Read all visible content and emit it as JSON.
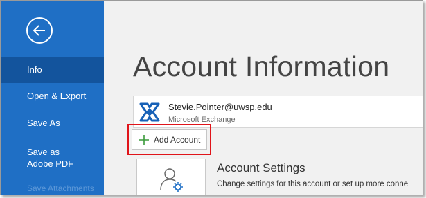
{
  "sidebar": {
    "items": [
      {
        "label": "Info"
      },
      {
        "label": "Open & Export"
      },
      {
        "label": "Save As"
      },
      {
        "label": "Save as Adobe PDF"
      },
      {
        "label": "Save Attachments"
      }
    ]
  },
  "main": {
    "title": "Account Information",
    "account": {
      "email": "Stevie.Pointer@uwsp.edu",
      "type": "Microsoft Exchange"
    },
    "add_account_label": "Add Account",
    "account_settings": {
      "title": "Account Settings",
      "description": "Change settings for this account or set up more conne"
    }
  },
  "colors": {
    "sidebar_bg": "#1f6fc5",
    "sidebar_active": "#13549d",
    "highlight_red": "#e0141a",
    "exchange_blue": "#1761b7",
    "plus_green": "#3a9a3a"
  }
}
